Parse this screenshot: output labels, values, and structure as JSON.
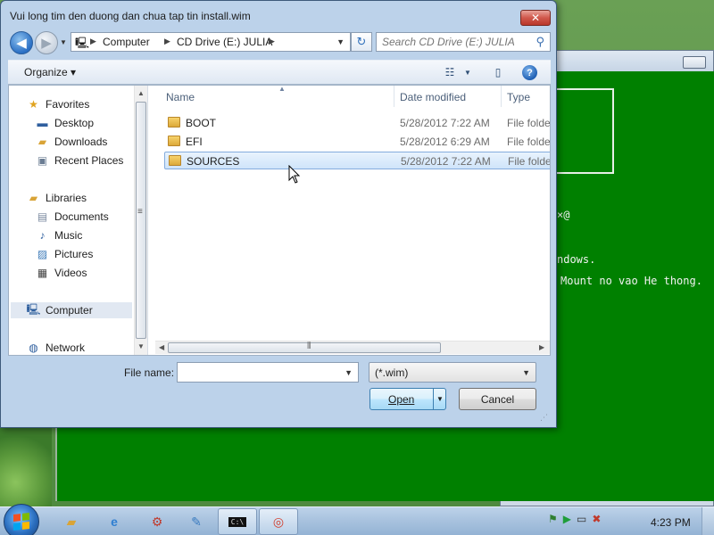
{
  "dialog": {
    "title": "Vui long tim den duong dan chua tap tin install.wim",
    "close_label": "✕"
  },
  "address_bar": {
    "segments": [
      "Computer",
      "CD Drive (E:) JULIA"
    ]
  },
  "search": {
    "placeholder": "Search CD Drive (E:) JULIA"
  },
  "toolbar": {
    "organize_label": "Organize"
  },
  "nav_pane": {
    "favorites": "Favorites",
    "desktop": "Desktop",
    "downloads": "Downloads",
    "recent_places": "Recent Places",
    "libraries": "Libraries",
    "documents": "Documents",
    "music": "Music",
    "pictures": "Pictures",
    "videos": "Videos",
    "computer": "Computer",
    "network": "Network"
  },
  "file_list": {
    "columns": {
      "name": "Name",
      "date": "Date modified",
      "type": "Type"
    },
    "rows": [
      {
        "name": "BOOT",
        "date": "5/28/2012 7:22 AM",
        "type": "File folder"
      },
      {
        "name": "EFI",
        "date": "5/28/2012 6:29 AM",
        "type": "File folder"
      },
      {
        "name": "SOURCES",
        "date": "5/28/2012 7:22 AM",
        "type": "File folder"
      }
    ]
  },
  "bottom": {
    "file_name_label": "File name:",
    "file_name_value": "",
    "filter_value": "(*.wim)",
    "open_label": "Open",
    "cancel_label": "Cancel"
  },
  "background_console": {
    "line1": "×@",
    "line2": "ndows.",
    "line3": "Mount no vao He thong."
  },
  "taskbar": {
    "clock": "4:23 PM"
  }
}
